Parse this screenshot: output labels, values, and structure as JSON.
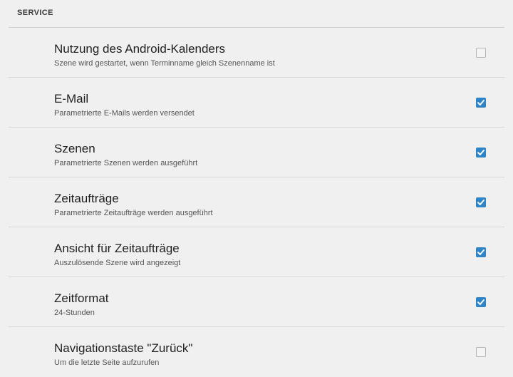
{
  "section": {
    "title": "SERVICE"
  },
  "settings": [
    {
      "title": "Nutzung des Android-Kalenders",
      "subtitle": "Szene wird gestartet, wenn Terminname gleich Szenenname ist",
      "checked": false
    },
    {
      "title": "E-Mail",
      "subtitle": "Parametrierte E-Mails werden versendet",
      "checked": true
    },
    {
      "title": "Szenen",
      "subtitle": "Parametrierte Szenen werden ausgeführt",
      "checked": true
    },
    {
      "title": "Zeitaufträge",
      "subtitle": "Parametrierte Zeitaufträge werden ausgeführt",
      "checked": true
    },
    {
      "title": "Ansicht für Zeitaufträge",
      "subtitle": "Auszulösende Szene wird angezeigt",
      "checked": true
    },
    {
      "title": "Zeitformat",
      "subtitle": "24-Stunden",
      "checked": true
    },
    {
      "title": "Navigationstaste \"Zurück\"",
      "subtitle": "Um die letzte Seite aufzurufen",
      "checked": false
    }
  ],
  "colors": {
    "accent": "#2f84c8",
    "background": "#f0f0f0",
    "divider": "#d8d8d8"
  },
  "icons": {
    "check": "checkmark-icon"
  }
}
